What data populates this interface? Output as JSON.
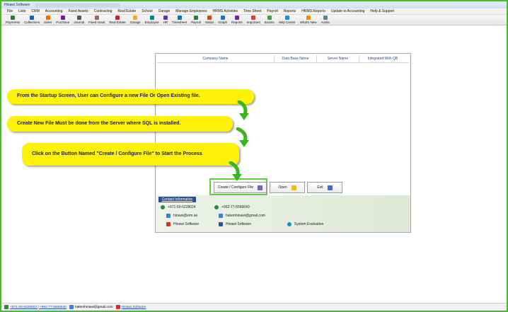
{
  "window": {
    "title": "Hinawi Software"
  },
  "menu": [
    "File",
    "Lists",
    "CRM",
    "Accounting",
    "Fixed Assets",
    "Contracting",
    "Real Estate",
    "School",
    "Garage",
    "Manage Employees",
    "HRMS Activities",
    "Time Sheet",
    "Payroll",
    "Reports",
    "HRMS Reports",
    "Update to Accounting",
    "Help & Support"
  ],
  "toolbar": [
    {
      "label": "Payments",
      "icon": "payments-icon",
      "color": "#2e7d32"
    },
    {
      "label": "Collections",
      "icon": "collections-icon",
      "color": "#1565c0"
    },
    {
      "label": "Sales",
      "icon": "sales-icon",
      "color": "#ef6c00"
    },
    {
      "label": "Purchase",
      "icon": "purchase-icon",
      "color": "#6a1b9a"
    },
    {
      "label": "Journal",
      "icon": "journal-icon",
      "color": "#455a64"
    },
    {
      "label": "Fixed Asset",
      "icon": "fixed-asset-icon",
      "color": "#8d6e63"
    },
    {
      "label": "Real Estate",
      "icon": "real-estate-icon",
      "color": "#c62828"
    },
    {
      "label": "Garage",
      "icon": "garage-icon",
      "color": "#f9a825"
    },
    {
      "label": "Employee",
      "icon": "employee-icon",
      "color": "#00897b"
    },
    {
      "label": "HR",
      "icon": "hr-icon",
      "color": "#5e35b1"
    },
    {
      "label": "Timesheet",
      "icon": "timesheet-icon",
      "color": "#0277bd"
    },
    {
      "label": "Payroll",
      "icon": "payroll-icon",
      "color": "#2e7d32"
    },
    {
      "label": "Status",
      "icon": "status-icon",
      "color": "#d84315"
    },
    {
      "label": "Graph",
      "icon": "graph-icon",
      "color": "#1976d2"
    },
    {
      "label": "Reports",
      "icon": "reports-icon",
      "color": "#7b1fa2"
    },
    {
      "label": "Important",
      "icon": "important-icon",
      "color": "#e53935"
    },
    {
      "label": "Exams",
      "icon": "exams-icon",
      "color": "#43a047"
    },
    {
      "label": "Help Center",
      "icon": "help-center-icon",
      "color": "#1e88e5"
    },
    {
      "label": "What's New",
      "icon": "whats-new-icon",
      "color": "#fb8c00"
    },
    {
      "label": "Arabic",
      "icon": "arabic-icon",
      "color": "#607d8b"
    }
  ],
  "grid": {
    "columns": [
      "Company Name",
      "Data Base Name",
      "Server Name",
      "Integrated With QB"
    ]
  },
  "buttons": {
    "create": "Create / Configure File",
    "open": "Open",
    "exit": "Exit"
  },
  "contact": {
    "tab": "Contact Information",
    "phone1": "+971-50-6228024",
    "phone2": "+962-77-5566640",
    "email1": "hinawi@eim.ae",
    "email2": "hatemhinawi@gmail.com",
    "youtube": "Hinawi Software",
    "facebook": "Hinawi Software",
    "evaluation": "System Evaluation"
  },
  "callouts": {
    "c1": "From the Startup Screen, User can Configure a new File Or Open Existing file.",
    "c2": "Create New File Must be done from the Server where SQL is installed.",
    "c3": "Click on the Button Named \"Create / Configure File\" to Start the Process"
  },
  "status": {
    "phones": "+971-50-6228024 | +962-77-5566640",
    "email": "hatemhinawi@gmail.com",
    "youtube": "Hinawi Software"
  },
  "colors": {
    "frame": "#3fc21f",
    "callout": "#fff20a",
    "arrow": "#3cb521",
    "contact_tab": "#2d4f8f",
    "grid_header_text": "#1f4c8a"
  }
}
